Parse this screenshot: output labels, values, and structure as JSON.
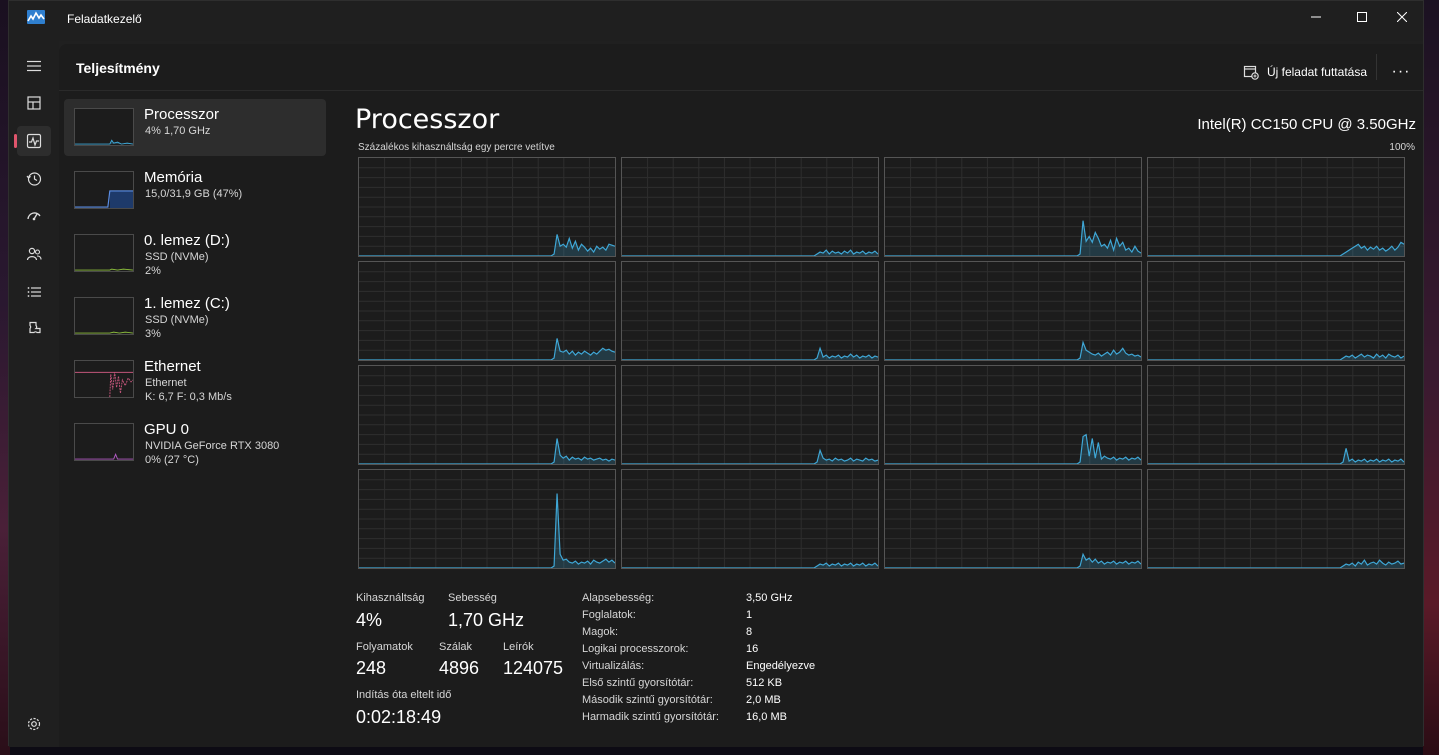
{
  "window": {
    "title": "Feladatkezelő"
  },
  "header": {
    "title": "Teljesítmény",
    "run_task_label": "Új feladat futtatása",
    "more_label": "···"
  },
  "nav": {
    "items": [
      "menu-icon",
      "processes-icon",
      "performance-icon",
      "app-history-icon",
      "startup-icon",
      "users-icon",
      "details-icon",
      "services-icon"
    ],
    "active": "performance-icon",
    "settings": "settings-icon"
  },
  "resources": [
    {
      "name": "Processzor",
      "line1": "4%  1,70 GHz",
      "line2": ""
    },
    {
      "name": "Memória",
      "line1": "15,0/31,9 GB (47%)",
      "line2": ""
    },
    {
      "name": "0. lemez (D:)",
      "line1": "SSD (NVMe)",
      "line2": "2%"
    },
    {
      "name": "1. lemez (C:)",
      "line1": "SSD (NVMe)",
      "line2": "3%"
    },
    {
      "name": "Ethernet",
      "line1": "Ethernet",
      "line2": "K: 6,7  F: 0,3 Mb/s"
    },
    {
      "name": "GPU 0",
      "line1": "NVIDIA GeForce RTX 3080",
      "line2": "0%  (27 °C)"
    }
  ],
  "performance": {
    "title": "Processzor",
    "model": "Intel(R) CC150 CPU @ 3.50GHz",
    "graph_caption": "Százalékos kihasználtság egy percre vetítve",
    "graph_max": "100%",
    "accent_color": "#3fa7d6",
    "core_history": [
      [
        0,
        0,
        0,
        0,
        0,
        0,
        0,
        0,
        0,
        0,
        0,
        0,
        0,
        0,
        0,
        0,
        0,
        0,
        0,
        0,
        0,
        0,
        0,
        0,
        0,
        0,
        0,
        0,
        0,
        0,
        0,
        0,
        0,
        0,
        0,
        0,
        0,
        0,
        0,
        0,
        0,
        0,
        0,
        0,
        0,
        0,
        0,
        0,
        0,
        0,
        0,
        0,
        0,
        0,
        0,
        0,
        0,
        0,
        0,
        0,
        0,
        0,
        0,
        0,
        2,
        22,
        10,
        12,
        9,
        18,
        8,
        15,
        6,
        12,
        9,
        5,
        8,
        4,
        10,
        7,
        9,
        6,
        12,
        11,
        10
      ],
      [
        0,
        0,
        0,
        0,
        0,
        0,
        0,
        0,
        0,
        0,
        0,
        0,
        0,
        0,
        0,
        0,
        0,
        0,
        0,
        0,
        0,
        0,
        0,
        0,
        0,
        0,
        0,
        0,
        0,
        0,
        0,
        0,
        0,
        0,
        0,
        0,
        0,
        0,
        0,
        0,
        0,
        0,
        0,
        0,
        0,
        0,
        0,
        0,
        0,
        0,
        0,
        0,
        0,
        0,
        0,
        0,
        0,
        0,
        0,
        0,
        0,
        0,
        0,
        0,
        2,
        4,
        3,
        6,
        2,
        5,
        3,
        4,
        2,
        5,
        3,
        6,
        2,
        4,
        3,
        5,
        2,
        4,
        3,
        5,
        2
      ],
      [
        0,
        0,
        0,
        0,
        0,
        0,
        0,
        0,
        0,
        0,
        0,
        0,
        0,
        0,
        0,
        0,
        0,
        0,
        0,
        0,
        0,
        0,
        0,
        0,
        0,
        0,
        0,
        0,
        0,
        0,
        0,
        0,
        0,
        0,
        0,
        0,
        0,
        0,
        0,
        0,
        0,
        0,
        0,
        0,
        0,
        0,
        0,
        0,
        0,
        0,
        0,
        0,
        0,
        0,
        0,
        0,
        0,
        0,
        0,
        0,
        0,
        0,
        0,
        0,
        2,
        36,
        15,
        20,
        14,
        24,
        18,
        10,
        12,
        8,
        16,
        6,
        18,
        10,
        14,
        6,
        8,
        4,
        10,
        5,
        3
      ],
      [
        0,
        0,
        0,
        0,
        0,
        0,
        0,
        0,
        0,
        0,
        0,
        0,
        0,
        0,
        0,
        0,
        0,
        0,
        0,
        0,
        0,
        0,
        0,
        0,
        0,
        0,
        0,
        0,
        0,
        0,
        0,
        0,
        0,
        0,
        0,
        0,
        0,
        0,
        0,
        0,
        0,
        0,
        0,
        0,
        0,
        0,
        0,
        0,
        0,
        0,
        0,
        0,
        0,
        0,
        0,
        0,
        0,
        0,
        0,
        0,
        0,
        0,
        0,
        0,
        2,
        4,
        6,
        8,
        10,
        12,
        8,
        10,
        6,
        9,
        7,
        10,
        6,
        8,
        5,
        7,
        10,
        6,
        9,
        14,
        12
      ],
      [
        0,
        0,
        0,
        0,
        0,
        0,
        0,
        0,
        0,
        0,
        0,
        0,
        0,
        0,
        0,
        0,
        0,
        0,
        0,
        0,
        0,
        0,
        0,
        0,
        0,
        0,
        0,
        0,
        0,
        0,
        0,
        0,
        0,
        0,
        0,
        0,
        0,
        0,
        0,
        0,
        0,
        0,
        0,
        0,
        0,
        0,
        0,
        0,
        0,
        0,
        0,
        0,
        0,
        0,
        0,
        0,
        0,
        0,
        0,
        0,
        0,
        0,
        0,
        0,
        2,
        22,
        9,
        8,
        10,
        6,
        9,
        5,
        8,
        6,
        9,
        7,
        5,
        8,
        6,
        9,
        12,
        10,
        11,
        9,
        8
      ],
      [
        0,
        0,
        0,
        0,
        0,
        0,
        0,
        0,
        0,
        0,
        0,
        0,
        0,
        0,
        0,
        0,
        0,
        0,
        0,
        0,
        0,
        0,
        0,
        0,
        0,
        0,
        0,
        0,
        0,
        0,
        0,
        0,
        0,
        0,
        0,
        0,
        0,
        0,
        0,
        0,
        0,
        0,
        0,
        0,
        0,
        0,
        0,
        0,
        0,
        0,
        0,
        0,
        0,
        0,
        0,
        0,
        0,
        0,
        0,
        0,
        0,
        0,
        0,
        0,
        2,
        12,
        3,
        5,
        2,
        4,
        3,
        5,
        2,
        4,
        3,
        6,
        3,
        5,
        2,
        4,
        3,
        5,
        2,
        4,
        3
      ],
      [
        0,
        0,
        0,
        0,
        0,
        0,
        0,
        0,
        0,
        0,
        0,
        0,
        0,
        0,
        0,
        0,
        0,
        0,
        0,
        0,
        0,
        0,
        0,
        0,
        0,
        0,
        0,
        0,
        0,
        0,
        0,
        0,
        0,
        0,
        0,
        0,
        0,
        0,
        0,
        0,
        0,
        0,
        0,
        0,
        0,
        0,
        0,
        0,
        0,
        0,
        0,
        0,
        0,
        0,
        0,
        0,
        0,
        0,
        0,
        0,
        0,
        0,
        0,
        0,
        2,
        18,
        10,
        8,
        6,
        5,
        7,
        4,
        6,
        8,
        5,
        10,
        6,
        8,
        12,
        7,
        5,
        6,
        4,
        5,
        3
      ],
      [
        0,
        0,
        0,
        0,
        0,
        0,
        0,
        0,
        0,
        0,
        0,
        0,
        0,
        0,
        0,
        0,
        0,
        0,
        0,
        0,
        0,
        0,
        0,
        0,
        0,
        0,
        0,
        0,
        0,
        0,
        0,
        0,
        0,
        0,
        0,
        0,
        0,
        0,
        0,
        0,
        0,
        0,
        0,
        0,
        0,
        0,
        0,
        0,
        0,
        0,
        0,
        0,
        0,
        0,
        0,
        0,
        0,
        0,
        0,
        0,
        0,
        0,
        0,
        0,
        2,
        4,
        3,
        5,
        2,
        4,
        6,
        3,
        5,
        4,
        2,
        6,
        3,
        5,
        2,
        6,
        4,
        3,
        5,
        2,
        4
      ],
      [
        0,
        0,
        0,
        0,
        0,
        0,
        0,
        0,
        0,
        0,
        0,
        0,
        0,
        0,
        0,
        0,
        0,
        0,
        0,
        0,
        0,
        0,
        0,
        0,
        0,
        0,
        0,
        0,
        0,
        0,
        0,
        0,
        0,
        0,
        0,
        0,
        0,
        0,
        0,
        0,
        0,
        0,
        0,
        0,
        0,
        0,
        0,
        0,
        0,
        0,
        0,
        0,
        0,
        0,
        0,
        0,
        0,
        0,
        0,
        0,
        0,
        0,
        0,
        0,
        2,
        26,
        9,
        6,
        8,
        4,
        7,
        5,
        6,
        4,
        7,
        5,
        6,
        4,
        5,
        6,
        4,
        5,
        3,
        5,
        4
      ],
      [
        0,
        0,
        0,
        0,
        0,
        0,
        0,
        0,
        0,
        0,
        0,
        0,
        0,
        0,
        0,
        0,
        0,
        0,
        0,
        0,
        0,
        0,
        0,
        0,
        0,
        0,
        0,
        0,
        0,
        0,
        0,
        0,
        0,
        0,
        0,
        0,
        0,
        0,
        0,
        0,
        0,
        0,
        0,
        0,
        0,
        0,
        0,
        0,
        0,
        0,
        0,
        0,
        0,
        0,
        0,
        0,
        0,
        0,
        0,
        0,
        0,
        0,
        0,
        0,
        2,
        14,
        6,
        4,
        5,
        3,
        6,
        4,
        5,
        3,
        4,
        6,
        3,
        5,
        4,
        3,
        6,
        4,
        5,
        3,
        4
      ],
      [
        0,
        0,
        0,
        0,
        0,
        0,
        0,
        0,
        0,
        0,
        0,
        0,
        0,
        0,
        0,
        0,
        0,
        0,
        0,
        0,
        0,
        0,
        0,
        0,
        0,
        0,
        0,
        0,
        0,
        0,
        0,
        0,
        0,
        0,
        0,
        0,
        0,
        0,
        0,
        0,
        0,
        0,
        0,
        0,
        0,
        0,
        0,
        0,
        0,
        0,
        0,
        0,
        0,
        0,
        0,
        0,
        0,
        0,
        0,
        0,
        0,
        0,
        0,
        0,
        2,
        28,
        30,
        8,
        26,
        6,
        22,
        5,
        8,
        6,
        5,
        7,
        4,
        6,
        5,
        7,
        4,
        6,
        5,
        7,
        4
      ],
      [
        0,
        0,
        0,
        0,
        0,
        0,
        0,
        0,
        0,
        0,
        0,
        0,
        0,
        0,
        0,
        0,
        0,
        0,
        0,
        0,
        0,
        0,
        0,
        0,
        0,
        0,
        0,
        0,
        0,
        0,
        0,
        0,
        0,
        0,
        0,
        0,
        0,
        0,
        0,
        0,
        0,
        0,
        0,
        0,
        0,
        0,
        0,
        0,
        0,
        0,
        0,
        0,
        0,
        0,
        0,
        0,
        0,
        0,
        0,
        0,
        0,
        0,
        0,
        0,
        2,
        16,
        3,
        5,
        2,
        4,
        3,
        5,
        2,
        4,
        3,
        5,
        2,
        4,
        3,
        5,
        2,
        4,
        3,
        5,
        2
      ],
      [
        0,
        0,
        0,
        0,
        0,
        0,
        0,
        0,
        0,
        0,
        0,
        0,
        0,
        0,
        0,
        0,
        0,
        0,
        0,
        0,
        0,
        0,
        0,
        0,
        0,
        0,
        0,
        0,
        0,
        0,
        0,
        0,
        0,
        0,
        0,
        0,
        0,
        0,
        0,
        0,
        0,
        0,
        0,
        0,
        0,
        0,
        0,
        0,
        0,
        0,
        0,
        0,
        0,
        0,
        0,
        0,
        0,
        0,
        0,
        0,
        0,
        0,
        0,
        0,
        2,
        76,
        14,
        8,
        9,
        6,
        5,
        7,
        4,
        6,
        5,
        7,
        4,
        8,
        6,
        5,
        7,
        9,
        6,
        8,
        5
      ],
      [
        0,
        0,
        0,
        0,
        0,
        0,
        0,
        0,
        0,
        0,
        0,
        0,
        0,
        0,
        0,
        0,
        0,
        0,
        0,
        0,
        0,
        0,
        0,
        0,
        0,
        0,
        0,
        0,
        0,
        0,
        0,
        0,
        0,
        0,
        0,
        0,
        0,
        0,
        0,
        0,
        0,
        0,
        0,
        0,
        0,
        0,
        0,
        0,
        0,
        0,
        0,
        0,
        0,
        0,
        0,
        0,
        0,
        0,
        0,
        0,
        0,
        0,
        0,
        0,
        2,
        4,
        3,
        5,
        2,
        4,
        3,
        5,
        2,
        4,
        3,
        5,
        2,
        4,
        3,
        5,
        2,
        4,
        3,
        5,
        2
      ],
      [
        0,
        0,
        0,
        0,
        0,
        0,
        0,
        0,
        0,
        0,
        0,
        0,
        0,
        0,
        0,
        0,
        0,
        0,
        0,
        0,
        0,
        0,
        0,
        0,
        0,
        0,
        0,
        0,
        0,
        0,
        0,
        0,
        0,
        0,
        0,
        0,
        0,
        0,
        0,
        0,
        0,
        0,
        0,
        0,
        0,
        0,
        0,
        0,
        0,
        0,
        0,
        0,
        0,
        0,
        0,
        0,
        0,
        0,
        0,
        0,
        0,
        0,
        0,
        0,
        2,
        14,
        8,
        10,
        6,
        9,
        5,
        7,
        4,
        6,
        5,
        7,
        4,
        6,
        5,
        7,
        4,
        6,
        5,
        7,
        4
      ],
      [
        0,
        0,
        0,
        0,
        0,
        0,
        0,
        0,
        0,
        0,
        0,
        0,
        0,
        0,
        0,
        0,
        0,
        0,
        0,
        0,
        0,
        0,
        0,
        0,
        0,
        0,
        0,
        0,
        0,
        0,
        0,
        0,
        0,
        0,
        0,
        0,
        0,
        0,
        0,
        0,
        0,
        0,
        0,
        0,
        0,
        0,
        0,
        0,
        0,
        0,
        0,
        0,
        0,
        0,
        0,
        0,
        0,
        0,
        0,
        0,
        0,
        0,
        0,
        0,
        2,
        4,
        3,
        5,
        2,
        6,
        4,
        8,
        3,
        5,
        6,
        4,
        8,
        5,
        3,
        6,
        4,
        5,
        7,
        4,
        5
      ]
    ]
  },
  "stats": {
    "utilization_label": "Kihasználtság",
    "utilization": "4%",
    "speed_label": "Sebesség",
    "speed": "1,70 GHz",
    "processes_label": "Folyamatok",
    "processes": "248",
    "threads_label": "Szálak",
    "threads": "4896",
    "handles_label": "Leírók",
    "handles": "124075",
    "uptime_label": "Indítás óta eltelt idő",
    "uptime": "0:02:18:49"
  },
  "specs": [
    {
      "key": "Alapsebesség:",
      "value": "3,50 GHz"
    },
    {
      "key": "Foglalatok:",
      "value": "1"
    },
    {
      "key": "Magok:",
      "value": "8"
    },
    {
      "key": "Logikai processzorok:",
      "value": "16"
    },
    {
      "key": "Virtualizálás:",
      "value": "Engedélyezve"
    },
    {
      "key": "Első szintű gyorsítótár:",
      "value": "512 KB"
    },
    {
      "key": "Második szintű gyorsítótár:",
      "value": "2,0 MB"
    },
    {
      "key": "Harmadik szintű gyorsítótár:",
      "value": "16,0 MB"
    }
  ]
}
